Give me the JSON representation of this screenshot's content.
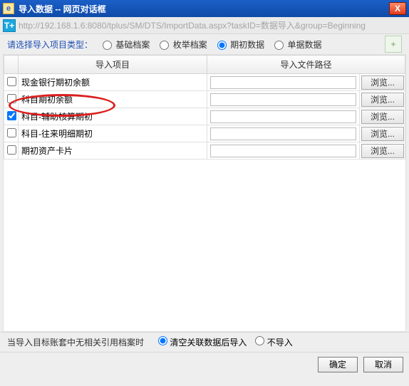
{
  "window": {
    "title": "导入数据 -- 网页对话框"
  },
  "url": "http://192.168.1.6:8080/tplus/SM/DTS/ImportData.aspx?taskID=数据导入&group=Beginning",
  "icons": {
    "ie_glyph": "e",
    "tplus_glyph": "T+",
    "close_glyph": "X",
    "corner_glyph": "+"
  },
  "filter": {
    "label": "请选择导入项目类型：",
    "options": [
      {
        "label": "基础档案",
        "checked": false
      },
      {
        "label": "枚举档案",
        "checked": false
      },
      {
        "label": "期初数据",
        "checked": true
      },
      {
        "label": "单据数据",
        "checked": false
      }
    ]
  },
  "table": {
    "headers": {
      "item": "导入项目",
      "path": "导入文件路径"
    },
    "browse_label": "浏览...",
    "rows": [
      {
        "checked": false,
        "name": "现金银行期初余额",
        "highlight": false
      },
      {
        "checked": false,
        "name": "科目期初余额",
        "highlight": false
      },
      {
        "checked": true,
        "name": "科目-辅助核算期初",
        "highlight": true
      },
      {
        "checked": false,
        "name": "科目-往来明细期初",
        "highlight": false
      },
      {
        "checked": false,
        "name": "期初资产卡片",
        "highlight": false
      }
    ]
  },
  "missing_ref": {
    "question": "当导入目标账套中无相关引用档案时",
    "options": [
      {
        "label": "清空关联数据后导入",
        "checked": true
      },
      {
        "label": "不导入",
        "checked": false
      }
    ]
  },
  "buttons": {
    "ok": "确定",
    "cancel": "取消"
  }
}
